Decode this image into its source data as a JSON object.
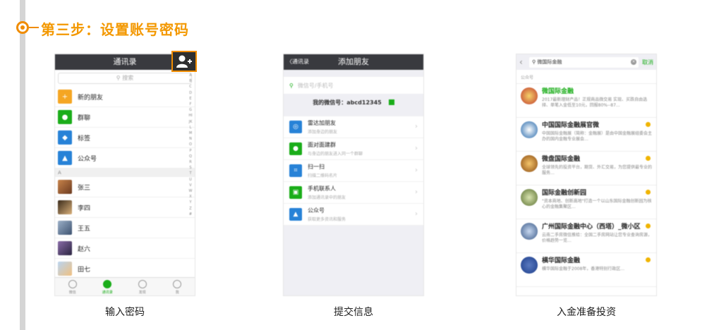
{
  "step": {
    "title": "第三步：设置账号密码"
  },
  "panels": [
    {
      "caption": "输入密码",
      "header": "通讯录",
      "search": "搜索",
      "items": [
        {
          "label": "新的朋友",
          "color": "#f5a623",
          "icon": "person-plus-icon"
        },
        {
          "label": "群聊",
          "color": "#1aad19",
          "icon": "group-icon"
        },
        {
          "label": "标签",
          "color": "#2782d7",
          "icon": "tag-icon"
        },
        {
          "label": "公众号",
          "color": "#2782d7",
          "icon": "official-account-icon"
        }
      ],
      "section": "A",
      "contacts": [
        "张三",
        "李四",
        "王五",
        "赵六",
        "田七"
      ],
      "index": "ABCDEFGHIJKLMNOPQRSTUVWXYZ#",
      "tabs": [
        "微信",
        "通讯录",
        "发现",
        "我"
      ]
    },
    {
      "caption": "提交信息",
      "header": "添加朋友",
      "back": "〈通讯录",
      "search": "微信号/手机号",
      "mine": "我的微信号：abcd12345",
      "rows": [
        {
          "title": "雷达加朋友",
          "sub": "添加身边的朋友",
          "color": "#2782d7"
        },
        {
          "title": "面对面建群",
          "sub": "与身边的朋友进入同一个群聊",
          "color": "#1aad19"
        },
        {
          "title": "扫一扫",
          "sub": "扫描二维码名片",
          "color": "#2782d7"
        },
        {
          "title": "手机联系人",
          "sub": "添加通讯录中的朋友",
          "color": "#1aad19"
        },
        {
          "title": "公众号",
          "sub": "获取更多资讯和服务",
          "color": "#2782d7"
        }
      ]
    },
    {
      "caption": "入金准备投资",
      "query": "微国际金融",
      "cancel": "取消",
      "section": "公众号",
      "results": [
        {
          "name": "微国际金融",
          "desc": "2017最新理财产品！正规商品微交易 实现、买跌自由选择、单笔入金低至10元，回报80%--87...",
          "color": "#c0392b"
        },
        {
          "name": "中国国际金融展官微",
          "desc": "中国国际金融展（简称：金融展）是由中国金融展组委会主办的国内金融专业展会...",
          "color": "#2266aa"
        },
        {
          "name": "微盘国际金融",
          "desc": "全球领先的投资平台，期货、外汇交易，为您提供最专业的服务...",
          "color": "#c77d1a"
        },
        {
          "name": "国际金融创新园",
          "desc": "\"资本商地、创新高地\"打造一个以山东国际金融创新园为核心的金融集聚区...",
          "color": "#8aa040"
        },
        {
          "name": "广州国际金融中心（西塔）_微小区",
          "desc": "云南二手房微信推给：全国二手房网站让您专业查询房源，价格趋势一览...",
          "color": "#6a8db8"
        },
        {
          "name": "横华国际金融",
          "desc": "横华国际金融于2008年，香港特别行政区...",
          "color": "#1c3d8a"
        }
      ]
    }
  ]
}
